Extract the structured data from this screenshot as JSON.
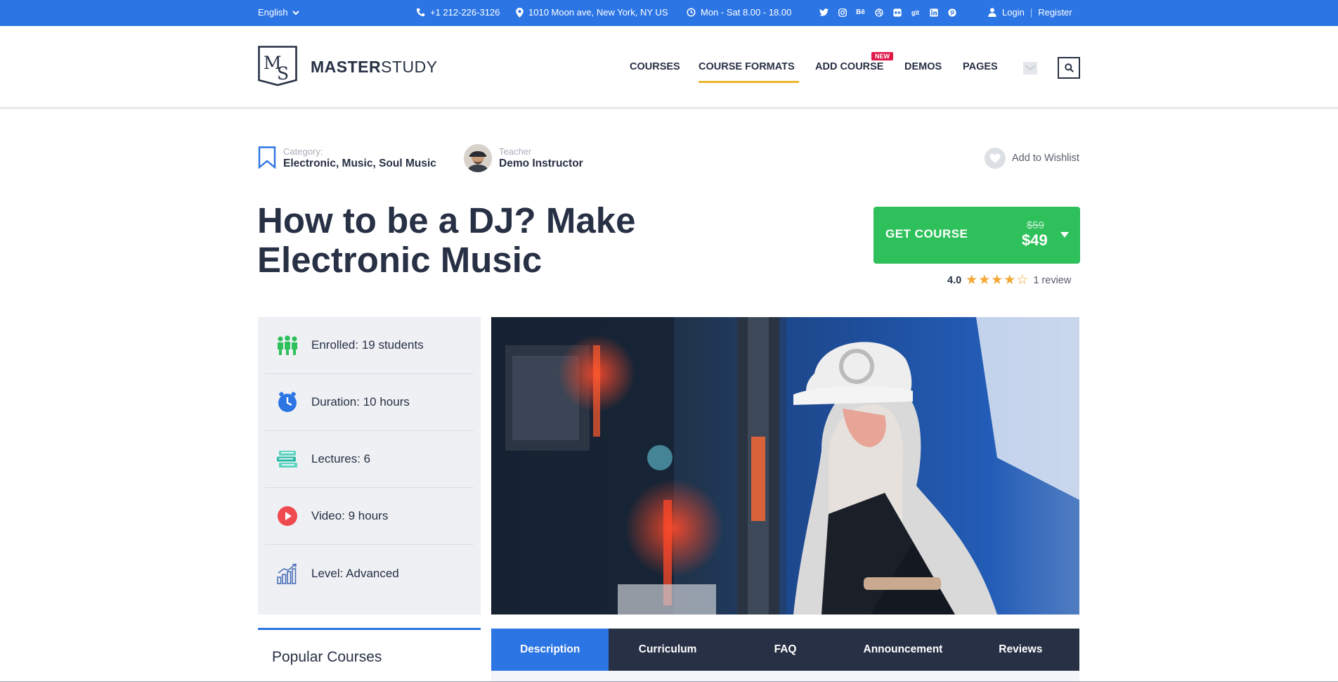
{
  "topbar": {
    "language": "English",
    "phone": "+1 212-226-3126",
    "address": "1010 Moon ave, New York, NY US",
    "hours": "Mon - Sat 8.00 - 18.00",
    "login": "Login",
    "register": "Register",
    "social": [
      "twitter-icon",
      "instagram-icon",
      "behance-icon",
      "dribbble-icon",
      "flickr-icon",
      "git-icon",
      "linkedin-icon",
      "pinterest-icon"
    ]
  },
  "header": {
    "logo_initials": "MS",
    "logo_bold": "MASTER",
    "logo_light": "STUDY",
    "nav": [
      {
        "label": "COURSES"
      },
      {
        "label": "COURSE FORMATS"
      },
      {
        "label": "ADD COURSE"
      },
      {
        "label": "DEMOS"
      },
      {
        "label": "PAGES"
      }
    ],
    "new_badge": "NEW"
  },
  "course": {
    "category_label": "Category:",
    "category_value": "Electronic, Music, Soul Music",
    "teacher_label": "Teacher",
    "teacher_value": "Demo Instructor",
    "wishlist": "Add to Wishlist",
    "title": "How to be a DJ? Make Electronic Music",
    "cta_label": "GET COURSE",
    "old_price": "$59",
    "price": "$49",
    "rating_score": "4.0",
    "rating_value": 4,
    "rating_max": 5,
    "reviews": "1 review"
  },
  "info": [
    {
      "label": "Enrolled: 19 students",
      "icon": "students-icon"
    },
    {
      "label": "Duration: 10 hours",
      "icon": "clock-icon"
    },
    {
      "label": "Lectures: 6",
      "icon": "books-icon"
    },
    {
      "label": "Video: 9 hours",
      "icon": "play-icon"
    },
    {
      "label": "Level: Advanced",
      "icon": "level-chart-icon"
    }
  ],
  "sidebar": {
    "popular_title": "Popular Courses"
  },
  "tabs": [
    {
      "label": "Description"
    },
    {
      "label": "Curriculum"
    },
    {
      "label": "FAQ"
    },
    {
      "label": "Announcement"
    },
    {
      "label": "Reviews"
    }
  ],
  "colors": {
    "brand_blue": "#2c75e4",
    "dark_navy": "#273044",
    "cta_green": "#2ec05b",
    "accent_yellow": "#eab830",
    "badge_red": "#e21a4a",
    "star_orange": "#f3a733"
  }
}
